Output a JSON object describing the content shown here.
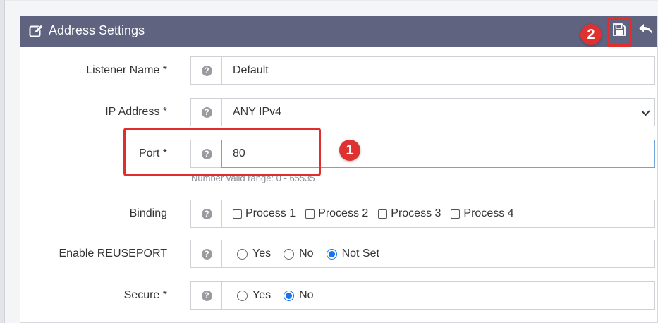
{
  "panel": {
    "title": "Address Settings",
    "header_icons": {
      "title_icon": "edit-icon",
      "save": "save-icon",
      "undo": "undo-icon"
    }
  },
  "annotations": {
    "badge_1": "1",
    "badge_2": "2",
    "highlight_color": "#e02d2d"
  },
  "fields": {
    "listener_name": {
      "label": "Listener Name *",
      "value": "Default"
    },
    "ip_address": {
      "label": "IP Address *",
      "value": "ANY IPv4"
    },
    "port": {
      "label": "Port *",
      "value": "80",
      "hint": "Number valid range: 0 - 65535"
    },
    "binding": {
      "label": "Binding",
      "options": [
        "Process 1",
        "Process 2",
        "Process 3",
        "Process 4"
      ]
    },
    "enable_reuseport": {
      "label": "Enable REUSEPORT",
      "options": [
        "Yes",
        "No",
        "Not Set"
      ],
      "selected": "Not Set"
    },
    "secure": {
      "label": "Secure *",
      "options": [
        "Yes",
        "No"
      ],
      "selected": "No"
    }
  },
  "help_icon_glyph": "?",
  "colors": {
    "header_bg": "#5f6380",
    "accent": "#1a73e8",
    "badge": "#e03131"
  }
}
